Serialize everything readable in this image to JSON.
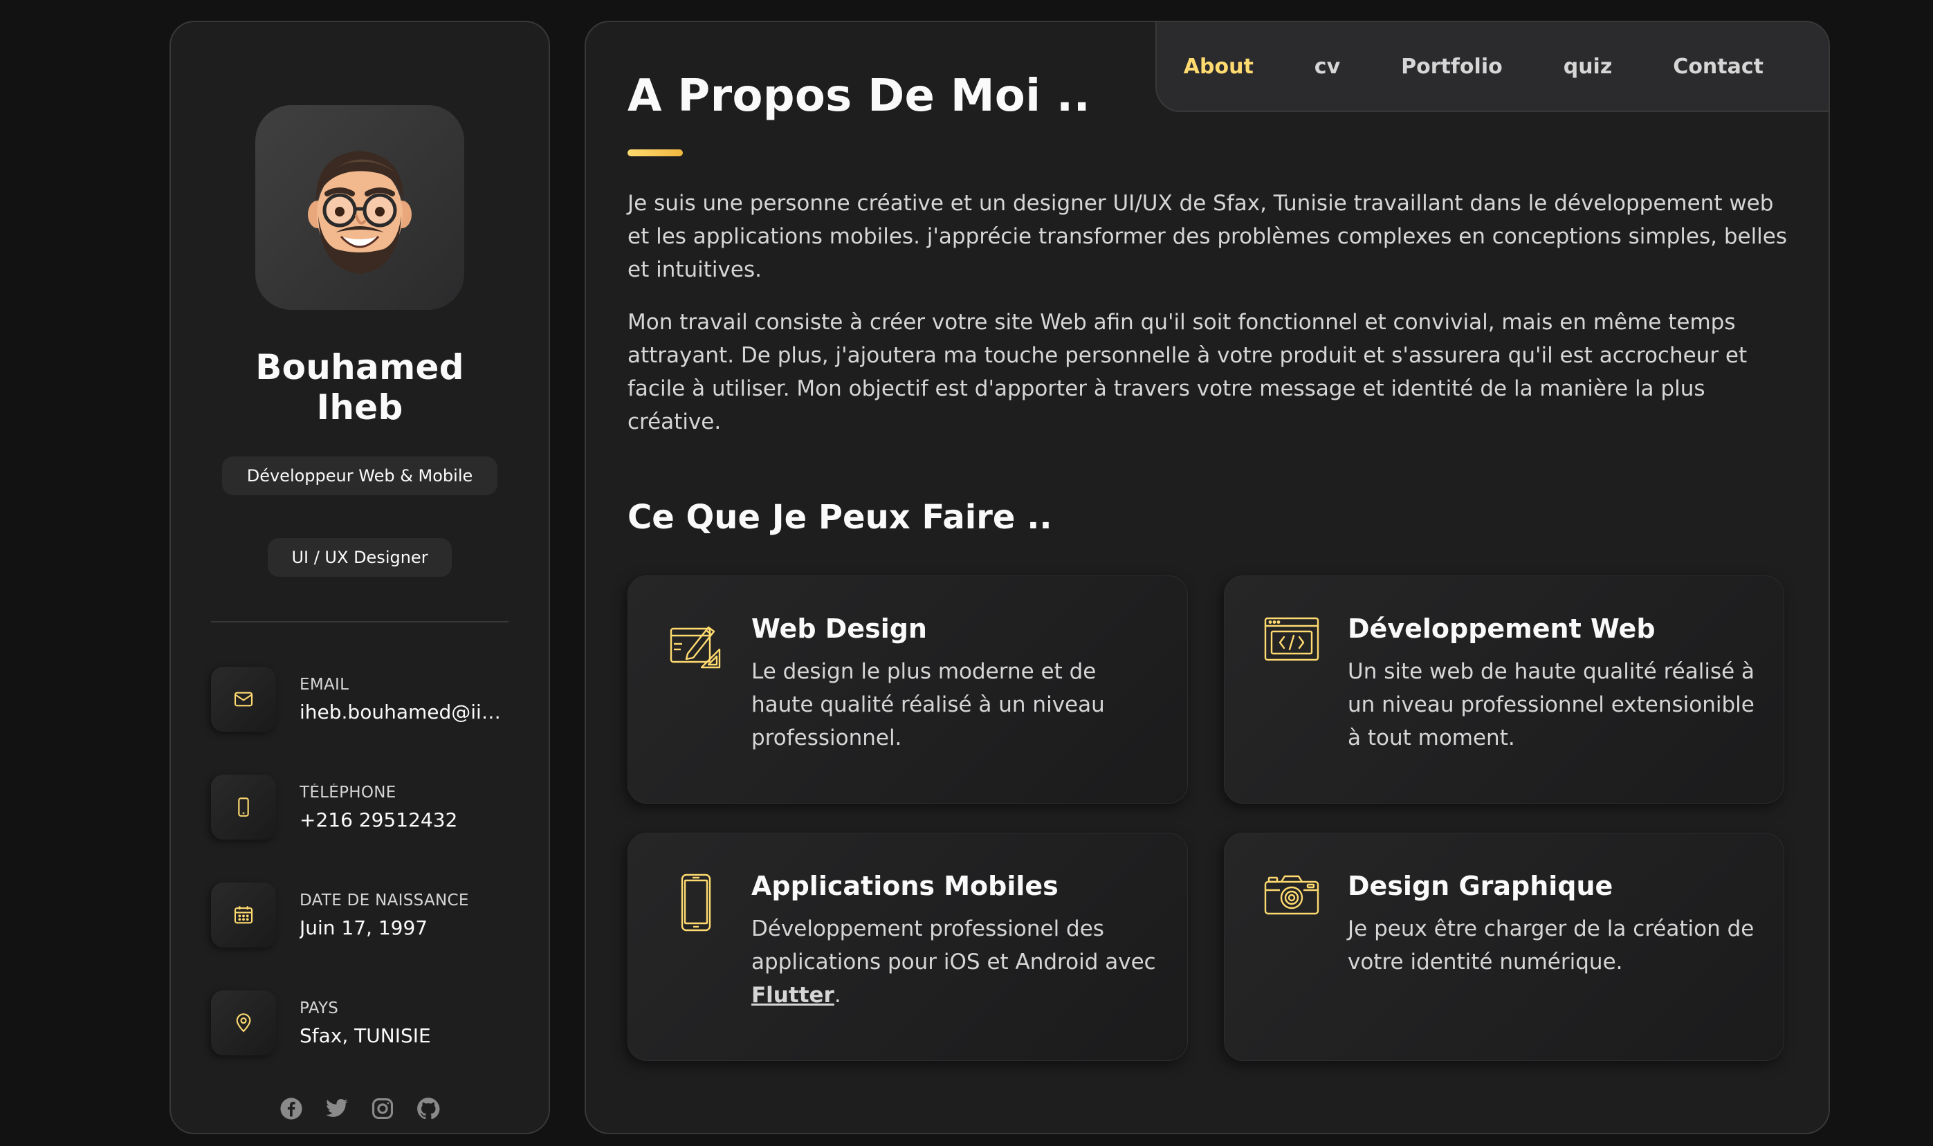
{
  "profile": {
    "name": "Bouhamed Iheb",
    "title_1": "Développeur Web & Mobile",
    "title_2": "UI / UX Designer"
  },
  "contacts": {
    "email": {
      "label": "Email",
      "value": "iheb.bouhamed@iit…"
    },
    "phone": {
      "label": "Téléphone",
      "value": "+216 29512432"
    },
    "birthday": {
      "label": "Date de naissance",
      "value": "Juin 17, 1997"
    },
    "location": {
      "label": "Pays",
      "value": "Sfax, TUNISIE"
    }
  },
  "socials": [
    "facebook-icon",
    "twitter-icon",
    "instagram-icon",
    "github-icon"
  ],
  "nav": {
    "about": "About",
    "cv": "cv",
    "portfolio": "Portfolio",
    "quiz": "quiz",
    "contact": "Contact",
    "active": "about"
  },
  "about": {
    "heading": "A Propos De Moi ..",
    "paragraph_1": "Je suis une personne créative et un designer UI/UX de Sfax, Tunisie travaillant dans le développement web et les applications mobiles. j'apprécie transformer des problèmes complexes en conceptions simples, belles et intuitives.",
    "paragraph_2": "Mon travail consiste à créer votre site Web afin qu'il soit fonctionnel et convivial, mais en même temps attrayant. De plus, j'ajoutera ma touche personnelle à votre produit et s'assurera qu'il est accrocheur et facile à utiliser. Mon objectif est d'apporter à travers votre message et identité de la manière la plus créative."
  },
  "services": {
    "heading": "Ce Que Je Peux Faire ..",
    "web_design": {
      "title": "Web Design",
      "desc": "Le design le plus moderne et de haute qualité réalisé à un niveau professionnel."
    },
    "web_dev": {
      "title": "Développement Web",
      "desc": "Un site web de haute qualité réalisé à un niveau professionnel extensionible à tout moment."
    },
    "mobile": {
      "title": "Applications Mobiles",
      "desc_before": "Développement professionel des applications pour iOS et Android avec ",
      "link": "Flutter",
      "desc_after": "."
    },
    "graphic": {
      "title": "Design Graphique",
      "desc": "Je peux être charger de la création de votre identité numérique."
    }
  },
  "colors": {
    "accent": "#ffdb70",
    "background": "#121212",
    "panel": "#1e1e1f",
    "text": "#fafafa",
    "muted": "#d6d6d6"
  }
}
